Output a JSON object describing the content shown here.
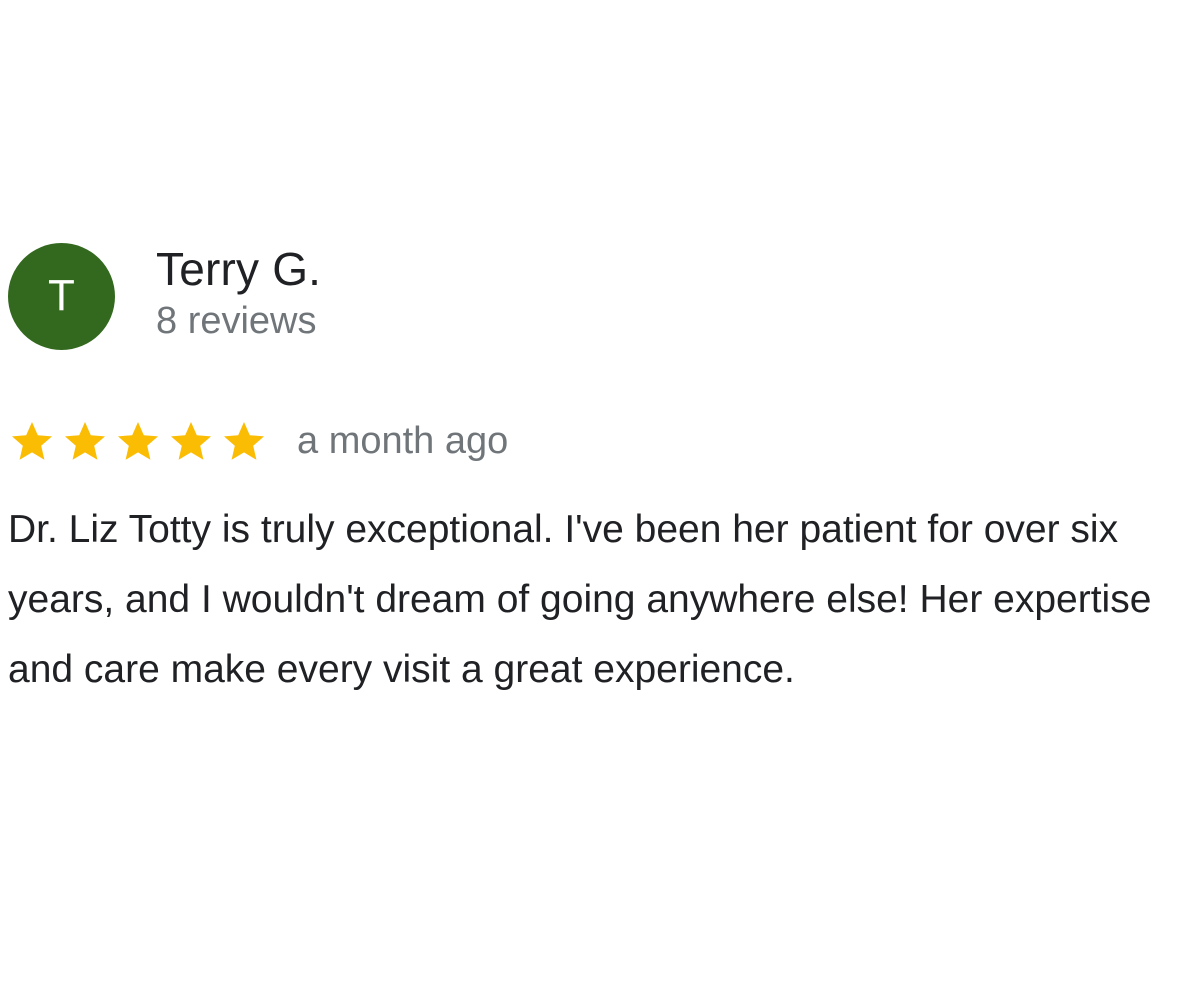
{
  "review": {
    "avatar_letter": "T",
    "avatar_color": "#33691e",
    "author_name": "Terry G.",
    "review_count": "8 reviews",
    "rating": 5,
    "rating_max": 5,
    "star_color": "#fbbc04",
    "star_icon": "star-icon",
    "time": "a month ago",
    "text": "Dr. Liz Totty is truly exceptional. I've been her patient for over six years, and I wouldn't dream of going anywhere else! Her expertise and care make every visit a great experience."
  }
}
